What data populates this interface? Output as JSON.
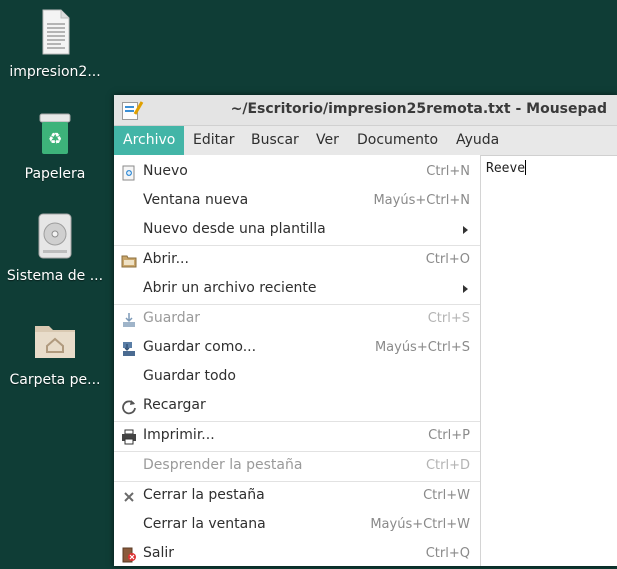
{
  "desktop": {
    "icons": [
      {
        "label": "impresion2...",
        "icon": "text-file-icon"
      },
      {
        "label": "Papelera",
        "icon": "trash-icon"
      },
      {
        "label": "Sistema de ...",
        "icon": "drive-icon"
      },
      {
        "label": "Carpeta pe...",
        "icon": "home-folder-icon"
      }
    ]
  },
  "window": {
    "title": "~/Escritorio/impresion25remota.txt - Mousepad",
    "app_icon": "mousepad-icon"
  },
  "menubar": {
    "items": [
      "Archivo",
      "Editar",
      "Buscar",
      "Ver",
      "Documento",
      "Ayuda"
    ],
    "active": "Archivo",
    "active_color": "#43b5a7"
  },
  "editor": {
    "text": "Reeve"
  },
  "file_menu": {
    "items": [
      {
        "label": "Nuevo",
        "accel": "Ctrl+N",
        "icon": "new-document-icon"
      },
      {
        "label": "Ventana nueva",
        "accel": "Mayús+Ctrl+N"
      },
      {
        "label": "Nuevo desde una plantilla",
        "submenu": true
      },
      {
        "label": "Abrir...",
        "accel": "Ctrl+O",
        "icon": "open-folder-icon"
      },
      {
        "label": "Abrir un archivo reciente",
        "submenu": true
      },
      {
        "label": "Guardar",
        "accel": "Ctrl+S",
        "icon": "save-icon",
        "disabled": true
      },
      {
        "label": "Guardar como...",
        "accel": "Mayús+Ctrl+S",
        "icon": "save-as-icon"
      },
      {
        "label": "Guardar todo"
      },
      {
        "label": "Recargar",
        "icon": "reload-icon"
      },
      {
        "label": "Imprimir...",
        "accel": "Ctrl+P",
        "icon": "print-icon"
      },
      {
        "label": "Desprender la pestaña",
        "accel": "Ctrl+D",
        "disabled": true
      },
      {
        "label": "Cerrar la pestaña",
        "accel": "Ctrl+W",
        "icon": "close-tab-icon"
      },
      {
        "label": "Cerrar la ventana",
        "accel": "Mayús+Ctrl+W"
      },
      {
        "label": "Salir",
        "accel": "Ctrl+Q",
        "icon": "quit-icon"
      }
    ]
  }
}
